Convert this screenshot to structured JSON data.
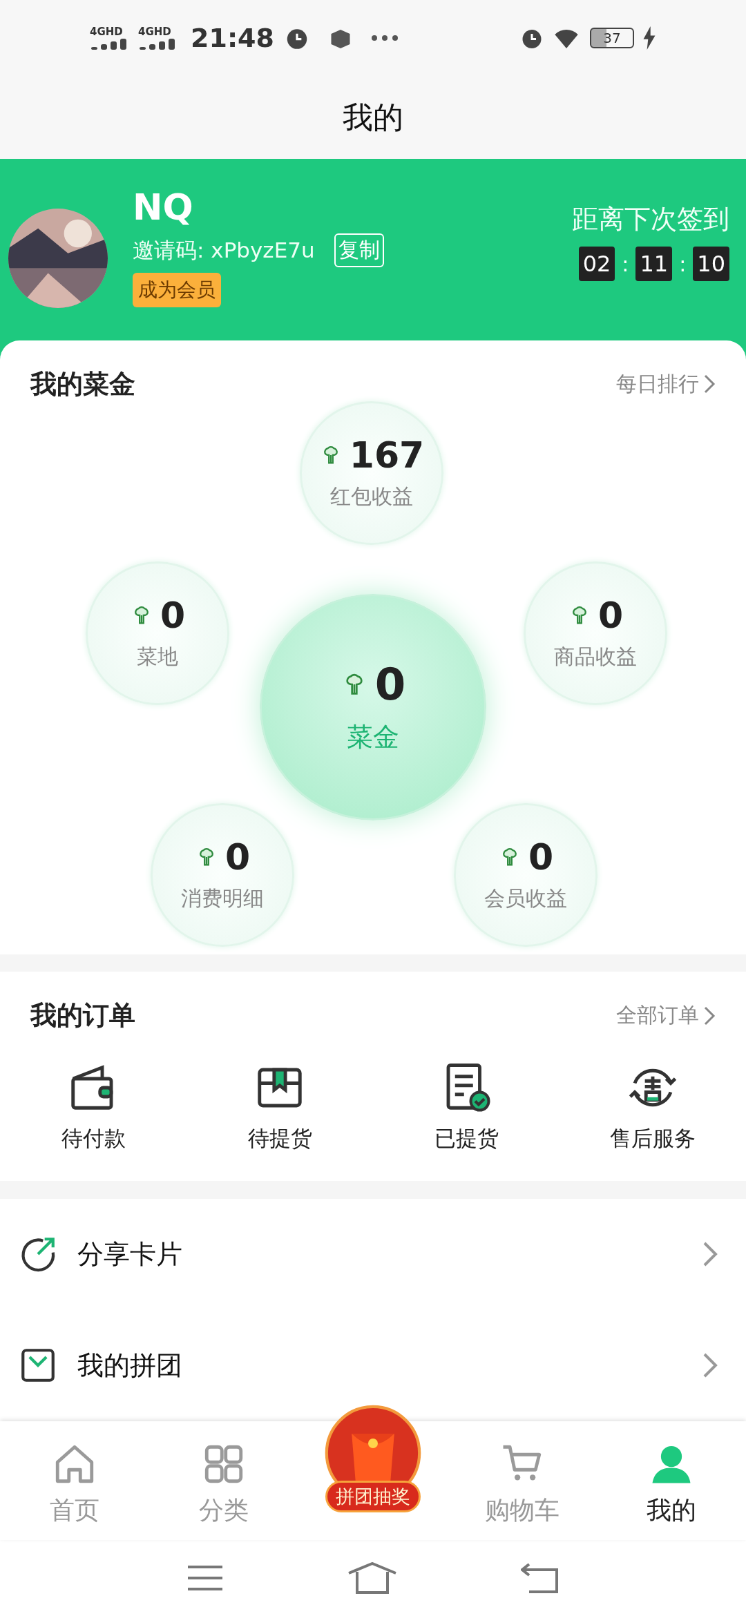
{
  "status_bar": {
    "signals": [
      {
        "network": "4G",
        "tag": "HD"
      },
      {
        "network": "4G",
        "tag": "HD"
      }
    ],
    "time": "21:48",
    "battery": "37"
  },
  "header": {
    "title": "我的"
  },
  "profile": {
    "name": "NQ",
    "invite": "邀请码: xPbyzE7u",
    "copy_button": "复制",
    "member_button": "成为会员",
    "countdown_label": "距离下次签到",
    "countdown": [
      {
        "kind": "digit",
        "text": "02"
      },
      {
        "kind": "sep",
        "text": ":"
      },
      {
        "kind": "digit",
        "text": "11"
      },
      {
        "kind": "sep",
        "text": ":"
      },
      {
        "kind": "digit",
        "text": "10"
      }
    ]
  },
  "wallet": {
    "title": "我的菜金",
    "link": "每日排行",
    "bubbles": [
      {
        "kind": "small",
        "value": "167",
        "label": "红包收益"
      },
      {
        "kind": "small",
        "value": "0",
        "label": "菜地"
      },
      {
        "kind": "small",
        "value": "0",
        "label": "商品收益"
      },
      {
        "kind": "main",
        "value": "0",
        "label": "菜金"
      },
      {
        "kind": "small",
        "value": "0",
        "label": "消费明细"
      },
      {
        "kind": "small",
        "value": "0",
        "label": "会员收益"
      }
    ]
  },
  "orders": {
    "title": "我的订单",
    "link": "全部订单",
    "items": [
      {
        "kind": "wallet",
        "label": "待付款"
      },
      {
        "kind": "box",
        "label": "待提货"
      },
      {
        "kind": "receipt",
        "label": "已提货"
      },
      {
        "kind": "service",
        "label": "售后服务"
      }
    ]
  },
  "menu": [
    {
      "kind": "share",
      "label": "分享卡片"
    },
    {
      "kind": "group",
      "label": "我的拼团"
    }
  ],
  "tabs": [
    {
      "kind": "home",
      "label": "首页",
      "selected": false
    },
    {
      "kind": "category",
      "label": "分类",
      "selected": false
    },
    {
      "kind": "promo",
      "label": "拼团抽奖",
      "selected": false
    },
    {
      "kind": "cart",
      "label": "购物车",
      "selected": false
    },
    {
      "kind": "user",
      "label": "我的",
      "selected": true
    }
  ]
}
